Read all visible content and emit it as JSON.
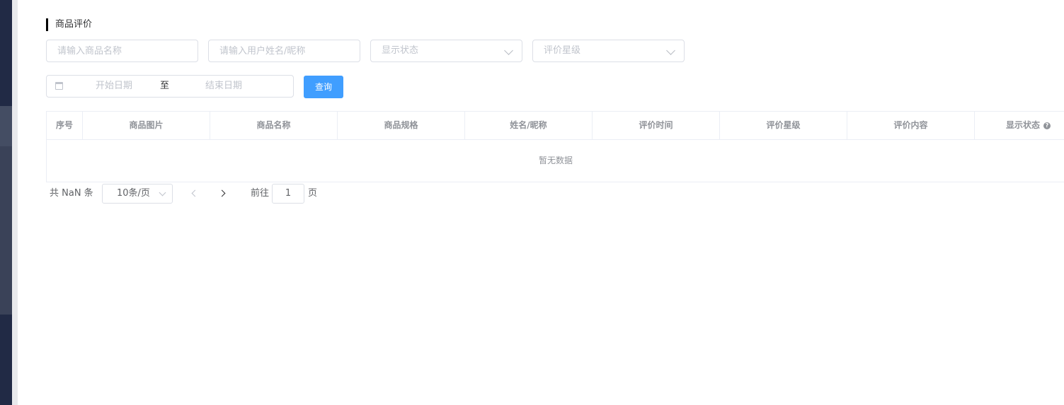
{
  "section": {
    "title": "商品评价"
  },
  "filters": {
    "product_name_placeholder": "请输入商品名称",
    "user_name_placeholder": "请输入用户姓名/昵称",
    "display_status_placeholder": "显示状态",
    "rating_placeholder": "评价星级",
    "date_start_placeholder": "开始日期",
    "date_separator": "至",
    "date_end_placeholder": "结束日期",
    "query_label": "查询"
  },
  "table": {
    "columns": [
      "序号",
      "商品图片",
      "商品名称",
      "商品规格",
      "姓名/昵称",
      "评价时间",
      "评价星级",
      "评价内容",
      "显示状态"
    ],
    "help_glyph": "?",
    "empty_text": "暂无数据"
  },
  "pagination": {
    "total_text": "共 NaN 条",
    "page_size": "10条/页",
    "goto_label": "前往",
    "current_page": "1",
    "page_unit": "页"
  },
  "colors": {
    "primary": "#409eff",
    "sidebar": "#212a45",
    "border": "#dcdfe6",
    "placeholder": "#c0c4cc"
  },
  "icons": [
    "calendar-icon",
    "chevron-down-icon",
    "help-icon",
    "chevron-left-icon",
    "chevron-right-icon"
  ]
}
